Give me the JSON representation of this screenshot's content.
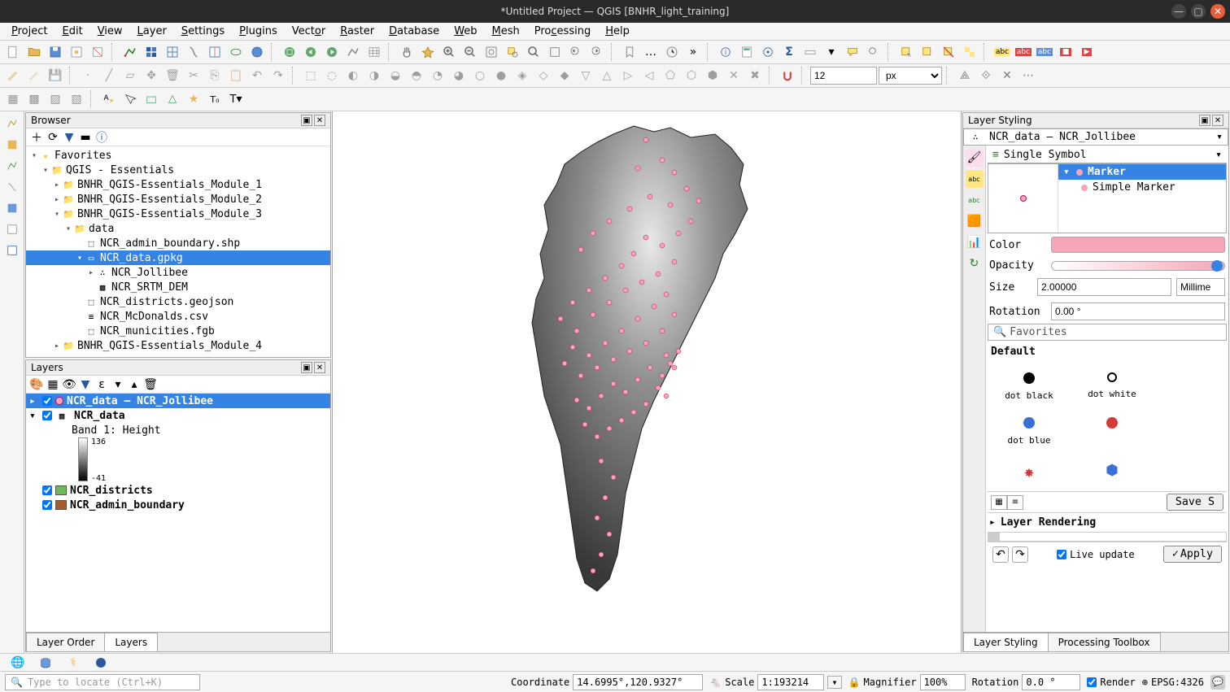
{
  "titlebar": {
    "title": "*Untitled Project — QGIS [BNHR_light_training]"
  },
  "menu": [
    "Project",
    "Edit",
    "View",
    "Layer",
    "Settings",
    "Plugins",
    "Vector",
    "Raster",
    "Database",
    "Web",
    "Mesh",
    "Processing",
    "Help"
  ],
  "toolbar_misc": {
    "spin_value": "12",
    "spin_unit": "px"
  },
  "browser": {
    "title": "Browser",
    "favorites_label": "Favorites",
    "root_folder": "QGIS - Essentials",
    "modules": [
      "BNHR_QGIS-Essentials_Module_1",
      "BNHR_QGIS-Essentials_Module_2",
      "BNHR_QGIS-Essentials_Module_3"
    ],
    "data_folder": "data",
    "data_items": {
      "shp": "NCR_admin_boundary.shp",
      "gpkg": "NCR_data.gpkg",
      "gpkg_children": [
        "NCR_Jollibee",
        "NCR_SRTM_DEM"
      ],
      "geojson": "NCR_districts.geojson",
      "csv": "NCR_McDonalds.csv",
      "fgb": "NCR_municities.fgb"
    },
    "module4": "BNHR_QGIS-Essentials_Module_4"
  },
  "layers": {
    "title": "Layers",
    "items": [
      {
        "name": "NCR_data — NCR_Jollibee",
        "checked": true,
        "selected": true,
        "sym": "point",
        "color": "#f5a6b8"
      },
      {
        "name": "NCR_data",
        "checked": true,
        "sym": "raster"
      },
      {
        "name": "NCR_districts",
        "checked": true,
        "sym": "square",
        "color": "#6bba5a"
      },
      {
        "name": "NCR_admin_boundary",
        "checked": true,
        "sym": "square",
        "color": "#a65a2e"
      }
    ],
    "band_label": "Band 1: Height",
    "band_max": "136",
    "band_min": "-41",
    "tab_order": "Layer Order",
    "tab_layers": "Layers"
  },
  "styling": {
    "title": "Layer Styling",
    "layer_combo": "NCR_data — NCR_Jollibee",
    "renderer": "Single Symbol",
    "tree": {
      "marker": "Marker",
      "simple": "Simple Marker"
    },
    "props": {
      "color_label": "Color",
      "color": "#f5a6b8",
      "opacity_label": "Opacity",
      "size_label": "Size",
      "size": "2.00000",
      "unit": "Millime",
      "rotation_label": "Rotation",
      "rotation": "0.00 °"
    },
    "fav_placeholder": "Favorites",
    "default_label": "Default",
    "symbols": [
      {
        "label": "dot black",
        "fill": "#000",
        "stroke": "#000"
      },
      {
        "label": "dot white",
        "fill": "#fff",
        "stroke": "#000"
      },
      {
        "label": "dot blue",
        "fill": "#3a6fd8",
        "stroke": "#3a6fd8"
      }
    ],
    "save_label": "Save S",
    "rendering_label": "Layer Rendering",
    "live_update": "Live update",
    "apply": "Apply",
    "tab_styling": "Layer Styling",
    "tab_toolbox": "Processing Toolbox"
  },
  "statusbar": {
    "locator_placeholder": "Type to locate (Ctrl+K)",
    "coord_label": "Coordinate",
    "coord": "14.6995°,120.9327°",
    "scale_label": "Scale",
    "scale": "1:193214",
    "magnifier_label": "Magnifier",
    "magnifier": "100%",
    "rotation_label": "Rotation",
    "rotation": "0.0 °",
    "render_label": "Render",
    "crs": "EPSG:4326"
  }
}
